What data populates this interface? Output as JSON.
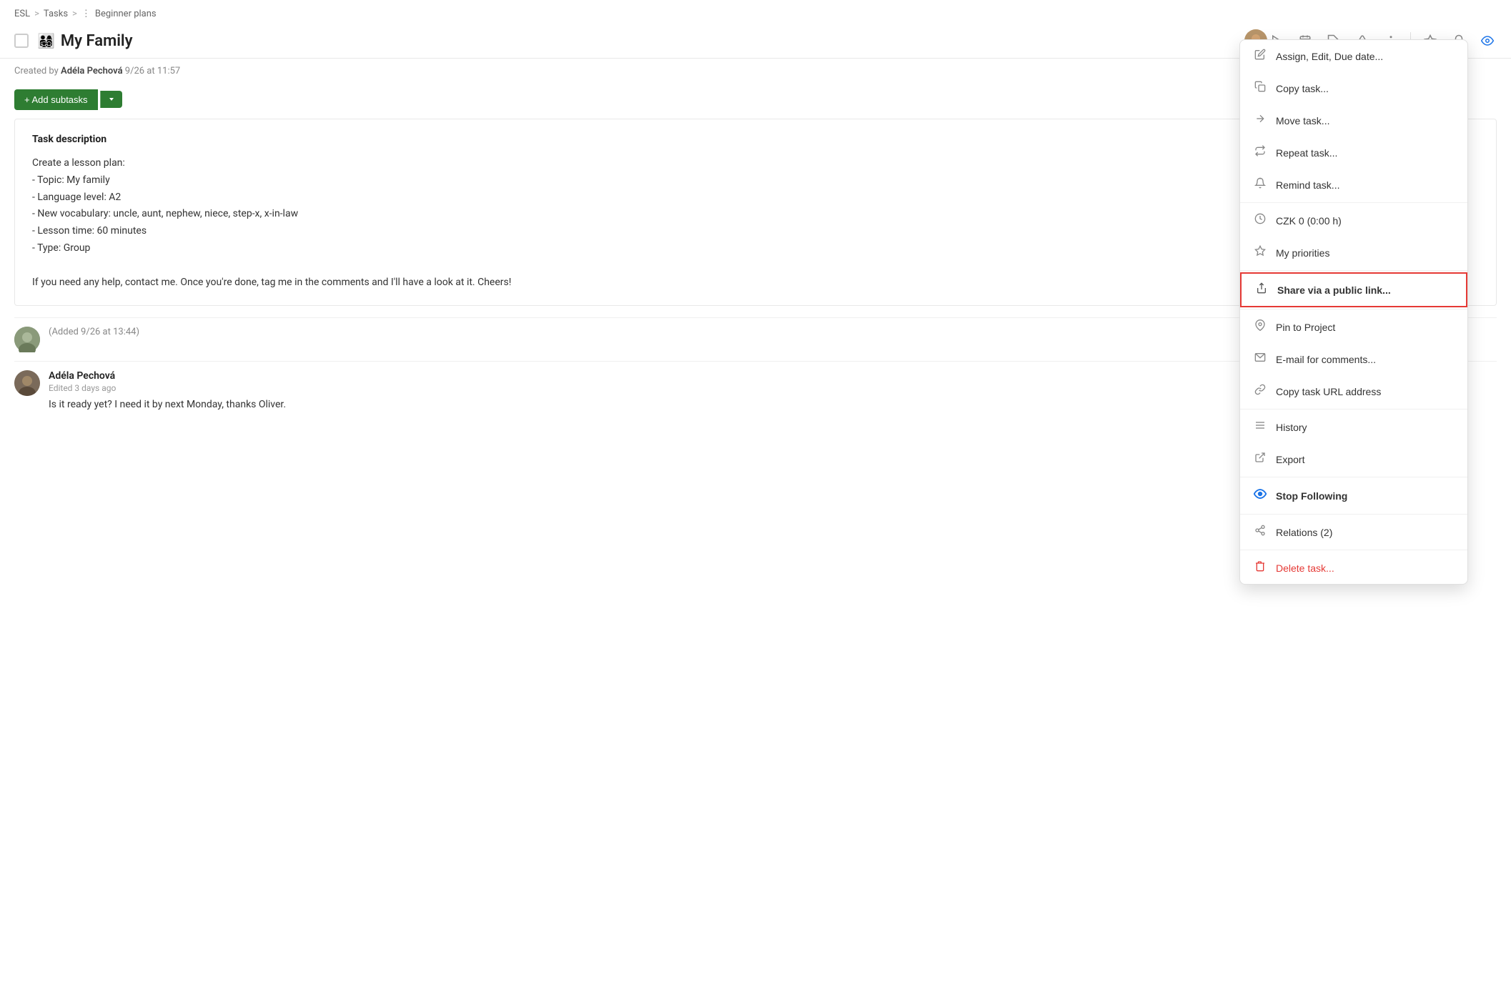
{
  "breadcrumb": {
    "items": [
      "ESL",
      "Tasks",
      "Beginner plans"
    ],
    "separators": [
      ">",
      ">"
    ]
  },
  "task": {
    "title": "My Family",
    "emoji": "👨‍👩‍👧‍👦",
    "created_by": "Adéla Pechová",
    "created_at": "9/26 at 11:57",
    "description_label": "Task description",
    "description_lines": [
      "Create a lesson plan:",
      "- Topic: My family",
      "- Language level: A2",
      "- New vocabulary: uncle, aunt, nephew, niece, step-x, x-in-law",
      "- Lesson time: 60 minutes",
      "- Type: Group",
      "",
      "If you need any help, contact me. Once you're done, tag me in the comments and I'll have a look at it. Cheers!"
    ]
  },
  "toolbar": {
    "add_subtasks_label": "+ Add subtasks",
    "play_icon": "▷",
    "calendar_icon": "📅",
    "tag_icon": "🏷",
    "alert_icon": "⚠",
    "more_icon": "⋮",
    "star_icon": "☆",
    "bell_icon": "🔔",
    "eye_icon": "👁"
  },
  "comments": [
    {
      "id": 1,
      "author": "",
      "time": "(Added 9/26 at 13:44)",
      "text": "",
      "is_system": true
    },
    {
      "id": 2,
      "author": "Adéla Pechová",
      "time": "Edited 3 days ago",
      "text": "Is it ready yet? I need it by next Monday, thanks Oliver.",
      "is_system": false
    }
  ],
  "dropdown": {
    "items": [
      {
        "id": "assign-edit",
        "label": "Assign, Edit, Due date...",
        "icon": "pencil"
      },
      {
        "id": "copy-task",
        "label": "Copy task...",
        "icon": "copy"
      },
      {
        "id": "move-task",
        "label": "Move task...",
        "icon": "arrow-right"
      },
      {
        "id": "repeat-task",
        "label": "Repeat task...",
        "icon": "repeat"
      },
      {
        "id": "remind-task",
        "label": "Remind task...",
        "icon": "bell"
      },
      {
        "id": "time",
        "label": "CZK 0 (0:00 h)",
        "icon": "clock"
      },
      {
        "id": "priorities",
        "label": "My priorities",
        "icon": "star"
      },
      {
        "id": "share-link",
        "label": "Share via a public link...",
        "icon": "share",
        "highlighted": true,
        "bold": true
      },
      {
        "id": "pin-project",
        "label": "Pin to Project",
        "icon": "pin"
      },
      {
        "id": "email-comments",
        "label": "E-mail for comments...",
        "icon": "email"
      },
      {
        "id": "copy-url",
        "label": "Copy task URL address",
        "icon": "link"
      },
      {
        "id": "history",
        "label": "History",
        "icon": "list"
      },
      {
        "id": "export",
        "label": "Export",
        "icon": "export"
      },
      {
        "id": "stop-following",
        "label": "Stop Following",
        "icon": "eye-circle",
        "bold": true
      },
      {
        "id": "relations",
        "label": "Relations (2)",
        "icon": "relations"
      },
      {
        "id": "delete-task",
        "label": "Delete task...",
        "icon": "trash",
        "red": true
      }
    ]
  }
}
